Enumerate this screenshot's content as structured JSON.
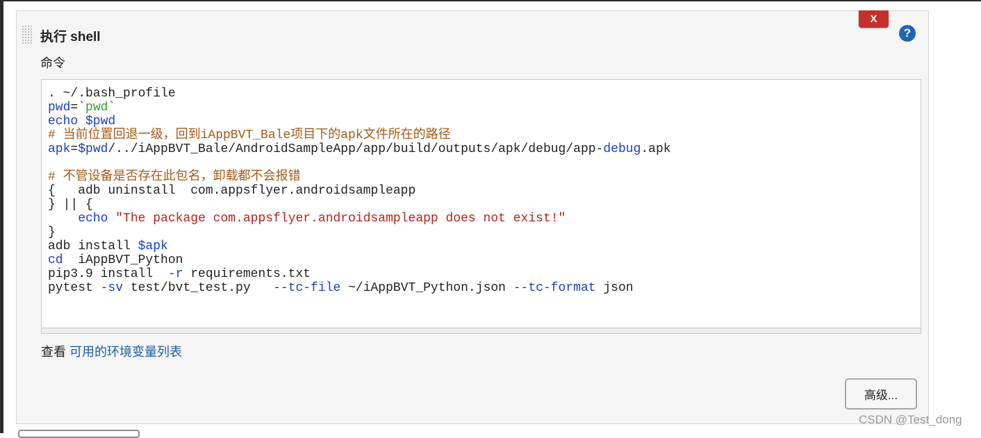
{
  "section": {
    "title": "执行 shell",
    "delete_label": "X",
    "help_label": "?"
  },
  "command": {
    "label": "命令",
    "lines": [
      [
        {
          "t": ". ~/.bash_profile",
          "c": ""
        }
      ],
      [
        {
          "t": "pwd",
          "c": "v"
        },
        {
          "t": "=`",
          "c": ""
        },
        {
          "t": "pwd",
          "c": "s"
        },
        {
          "t": "`",
          "c": ""
        }
      ],
      [
        {
          "t": "echo $pwd",
          "c": "k"
        }
      ],
      [
        {
          "t": "# 当前位置回退一级，回到iAppBVT_Bale项目下的apk文件所在的路径",
          "c": "c"
        }
      ],
      [
        {
          "t": "apk",
          "c": "v"
        },
        {
          "t": "=",
          "c": ""
        },
        {
          "t": "$pwd",
          "c": "v"
        },
        {
          "t": "/../iAppBVT_Bale/AndroidSampleApp/app/build/outputs/apk/debug/app-",
          "c": ""
        },
        {
          "t": "debug",
          "c": "k"
        },
        {
          "t": ".apk",
          "c": ""
        }
      ],
      [
        {
          "t": "",
          "c": ""
        }
      ],
      [
        {
          "t": "# 不管设备是否存在此包名，卸载都不会报错",
          "c": "c"
        }
      ],
      [
        {
          "t": "{   adb uninstall  com.appsflyer.androidsampleapp",
          "c": ""
        }
      ],
      [
        {
          "t": "} || {",
          "c": ""
        }
      ],
      [
        {
          "t": "    ",
          "c": ""
        },
        {
          "t": "echo",
          "c": "k"
        },
        {
          "t": " ",
          "c": ""
        },
        {
          "t": "\"The package com.appsflyer.androidsampleapp does not exist!\"",
          "c": "q"
        }
      ],
      [
        {
          "t": "}",
          "c": ""
        }
      ],
      [
        {
          "t": "adb install ",
          "c": ""
        },
        {
          "t": "$apk",
          "c": "v"
        }
      ],
      [
        {
          "t": "cd",
          "c": "k"
        },
        {
          "t": "  iAppBVT_Python",
          "c": ""
        }
      ],
      [
        {
          "t": "pip3.9 install  ",
          "c": ""
        },
        {
          "t": "-r",
          "c": "k"
        },
        {
          "t": " requirements.txt",
          "c": ""
        }
      ],
      [
        {
          "t": "pytest ",
          "c": ""
        },
        {
          "t": "-sv",
          "c": "k"
        },
        {
          "t": " test/bvt_test.py   ",
          "c": ""
        },
        {
          "t": "--tc-file",
          "c": "k"
        },
        {
          "t": " ~/iAppBVT_Python.json ",
          "c": ""
        },
        {
          "t": "--tc-format",
          "c": "k"
        },
        {
          "t": " json",
          "c": ""
        }
      ]
    ]
  },
  "env": {
    "prefix": "查看",
    "link": "可用的环境变量列表"
  },
  "advanced_label": "高级...",
  "watermark": "CSDN @Test_dong"
}
